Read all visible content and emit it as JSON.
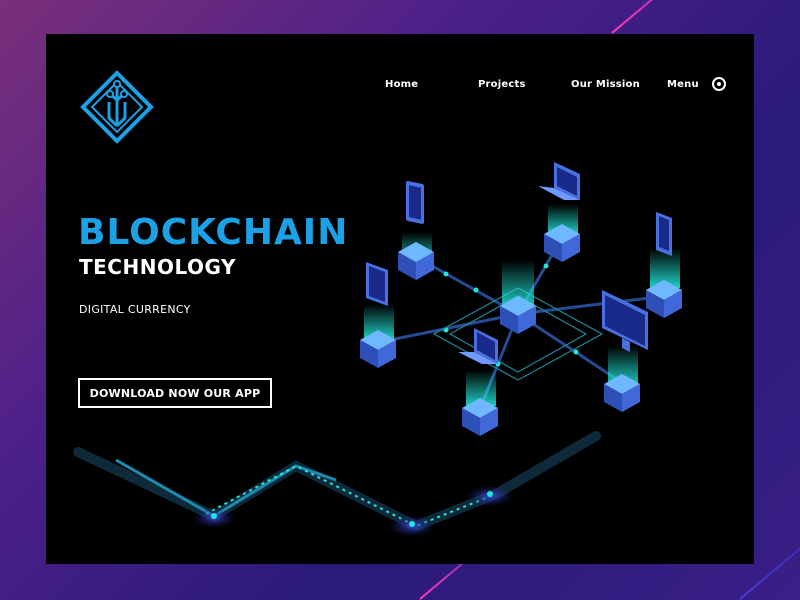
{
  "nav": {
    "items": [
      {
        "label": "Home"
      },
      {
        "label": "Projects"
      },
      {
        "label": "Our Mission"
      },
      {
        "label": "Menu"
      }
    ],
    "menu_icon": "target-icon"
  },
  "logo": {
    "icon": "circuit-diamond-logo"
  },
  "hero": {
    "title": "BLOCKCHAIN",
    "subtitle": "TECHNOLOGY",
    "tagline": "DIGITAL CURRENCY",
    "cta_label": "DOWNLOAD NOW OUR APP"
  },
  "colors": {
    "accent": "#1da1e6",
    "glow": "#22e6d8",
    "node": "#3f6fe0",
    "page_bg_start": "#7a2f7a",
    "page_bg_end": "#2a1a7a",
    "window_bg": "#000000"
  },
  "illustration": {
    "center_node": "server-block-icon",
    "devices": [
      "tablet-icon",
      "laptop-icon",
      "tablet-icon",
      "tablet-icon",
      "monitor-icon",
      "laptop-icon"
    ]
  }
}
